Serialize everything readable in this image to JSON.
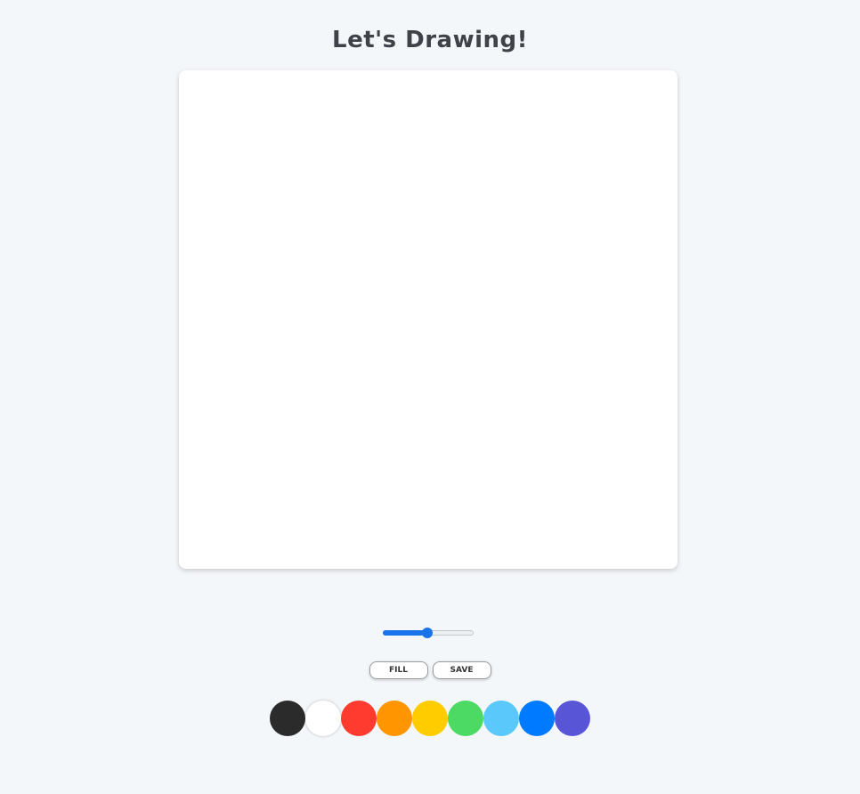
{
  "title": "Let's Drawing!",
  "brush_size": {
    "value": 50,
    "min": 0,
    "max": 100
  },
  "buttons": {
    "fill_label": "FILL",
    "save_label": "SAVE"
  },
  "palette": [
    {
      "name": "black",
      "color": "#2b2b2b"
    },
    {
      "name": "white",
      "color": "#ffffff"
    },
    {
      "name": "red",
      "color": "#ff3b30"
    },
    {
      "name": "orange",
      "color": "#ff9500"
    },
    {
      "name": "yellow",
      "color": "#ffcc00"
    },
    {
      "name": "green",
      "color": "#4cd964"
    },
    {
      "name": "light-blue",
      "color": "#5ac8fa"
    },
    {
      "name": "blue",
      "color": "#007aff"
    },
    {
      "name": "purple",
      "color": "#5856d6"
    }
  ],
  "accent_color": "#1a73e8"
}
